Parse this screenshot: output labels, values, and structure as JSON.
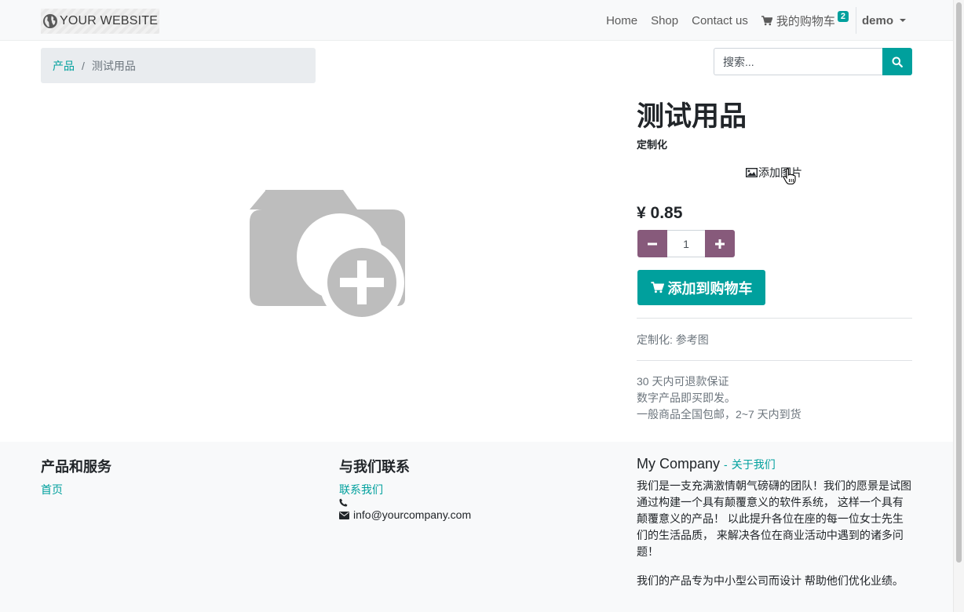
{
  "navbar": {
    "brand": "YOUR WEBSITE",
    "links": [
      {
        "label": "Home"
      },
      {
        "label": "Shop"
      },
      {
        "label": "Contact us"
      }
    ],
    "cart_label": "我的购物车",
    "cart_count": "2",
    "user": "demo"
  },
  "breadcrumb": {
    "parent": "产品",
    "separator": "/",
    "current": "测试用品"
  },
  "search": {
    "placeholder": "搜索..."
  },
  "product": {
    "title": "测试用品",
    "subtitle": "定制化",
    "add_image": "添加图片",
    "price": "¥ 0.85",
    "quantity": "1",
    "add_to_cart": "添加到购物车",
    "custom_info": "定制化: 参考图",
    "terms": [
      "30 天内可退款保证",
      "数字产品即买即发。",
      "一般商品全国包邮，2~7 天内到货"
    ]
  },
  "footer": {
    "col1": {
      "heading": "产品和服务",
      "link": "首页"
    },
    "col2": {
      "heading": "与我们联系",
      "link": "联系我们",
      "phone": "",
      "email": "info@yourcompany.com"
    },
    "col3": {
      "company": "My Company",
      "dash": "-",
      "about": "关于我们",
      "text1": "我们是一支充满激情朝气磅礴的团队！我们的愿景是试图通过构建一个具有颠覆意义的软件系统， 这样一个具有颠覆意义的产品！ 以此提升各位在座的每一位女士先生们的生活品质， 来解决各位在商业活动中遇到的诸多问题！",
      "text2": "我们的产品专为中小型公司而设计 帮助他们优化业绩。"
    }
  },
  "colors": {
    "primary": "#00a09d",
    "secondary": "#875a7b",
    "muted": "#6c757d",
    "navbar_bg": "#f8f9fa"
  }
}
